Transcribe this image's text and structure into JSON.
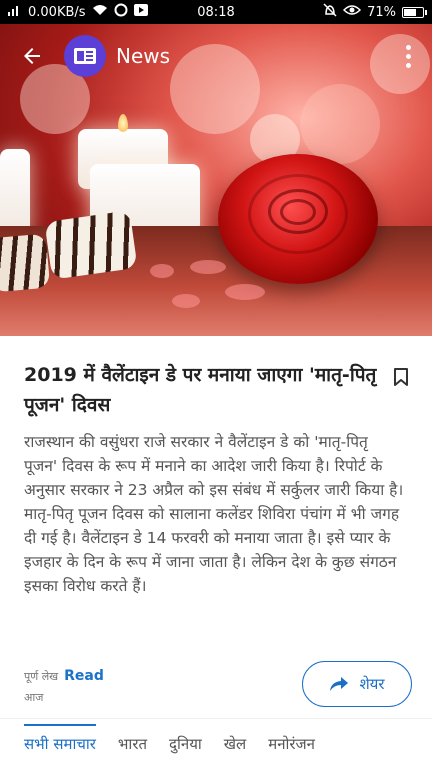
{
  "status_bar": {
    "network": "0.00KB/s",
    "time": "08:18",
    "battery": "71%",
    "battery_level": 0.71
  },
  "header": {
    "title": "News",
    "logo_color": "#5b3fd6",
    "back_icon": "arrow-left-icon",
    "menu_icon": "more-vert-icon"
  },
  "article": {
    "headline": "2019 में वैलेंटाइन डे पर मनाया जाएगा 'मातृ-पितृ पूजन' दिवस",
    "body": "राजस्थान की वसुंधरा राजे सरकार ने वैलेंटाइन डे को 'मातृ-पितृ पूजन' दिवस के रूप में मनाने का आदेश जारी किया है। रिपोर्ट के अनुसार सरकार ने 23 अप्रैल को इस संबंध में सर्कुलर जारी किया है। मातृ-पितृ पूजन दिवस को सालाना कलेंडर शिविरा पंचांग में भी जगह दी गई है। वैलेंटाइन डे 14 फरवरी को मनाया जाता है। इसे प्यार के इजहार के दिन के रूप में जाना जाता है। लेकिन देश के कुछ संगठन इसका विरोध करते हैं।",
    "bookmark_icon": "bookmark-icon"
  },
  "footer": {
    "read_label": "पूर्ण लेख",
    "read_link": "Read",
    "date": "आज",
    "share_label": "शेयर",
    "share_icon": "share-arrow-icon",
    "accent": "#1a6fc6"
  },
  "tabs": [
    {
      "label": "सभी समाचार",
      "active": true
    },
    {
      "label": "भारत",
      "active": false
    },
    {
      "label": "दुनिया",
      "active": false
    },
    {
      "label": "खेल",
      "active": false
    },
    {
      "label": "मनोरंजन",
      "active": false
    }
  ]
}
